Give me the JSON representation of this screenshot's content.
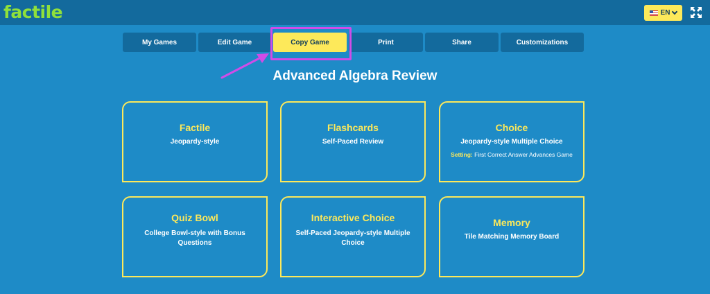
{
  "app": {
    "logo": "factile"
  },
  "header": {
    "language": "EN",
    "language_icon": "us-flag-icon",
    "fullscreen_icon": "fullscreen-icon"
  },
  "tabs": [
    {
      "label": "My Games"
    },
    {
      "label": "Edit Game"
    },
    {
      "label": "Copy Game",
      "active": true
    },
    {
      "label": "Print"
    },
    {
      "label": "Share"
    },
    {
      "label": "Customizations"
    }
  ],
  "page": {
    "title": "Advanced Algebra Review"
  },
  "game_modes": [
    {
      "title": "Factile",
      "description": "Jeopardy-style"
    },
    {
      "title": "Flashcards",
      "description": "Self-Paced Review"
    },
    {
      "title": "Choice",
      "description": "Jeopardy-style Multiple Choice",
      "setting_label": "Setting:",
      "setting_value": "First Correct Answer Advances Game"
    },
    {
      "title": "Quiz Bowl",
      "description": "College Bowl-style with Bonus Questions"
    },
    {
      "title": "Interactive Choice",
      "description": "Self-Paced Jeopardy-style Multiple Choice"
    },
    {
      "title": "Memory",
      "description": "Tile Matching Memory Board"
    }
  ],
  "colors": {
    "background": "#1e8bc7",
    "topbar": "#136a9d",
    "accent_yellow": "#fde95a",
    "logo_green": "#8fe03b",
    "annotation_magenta": "#d04ce8"
  }
}
